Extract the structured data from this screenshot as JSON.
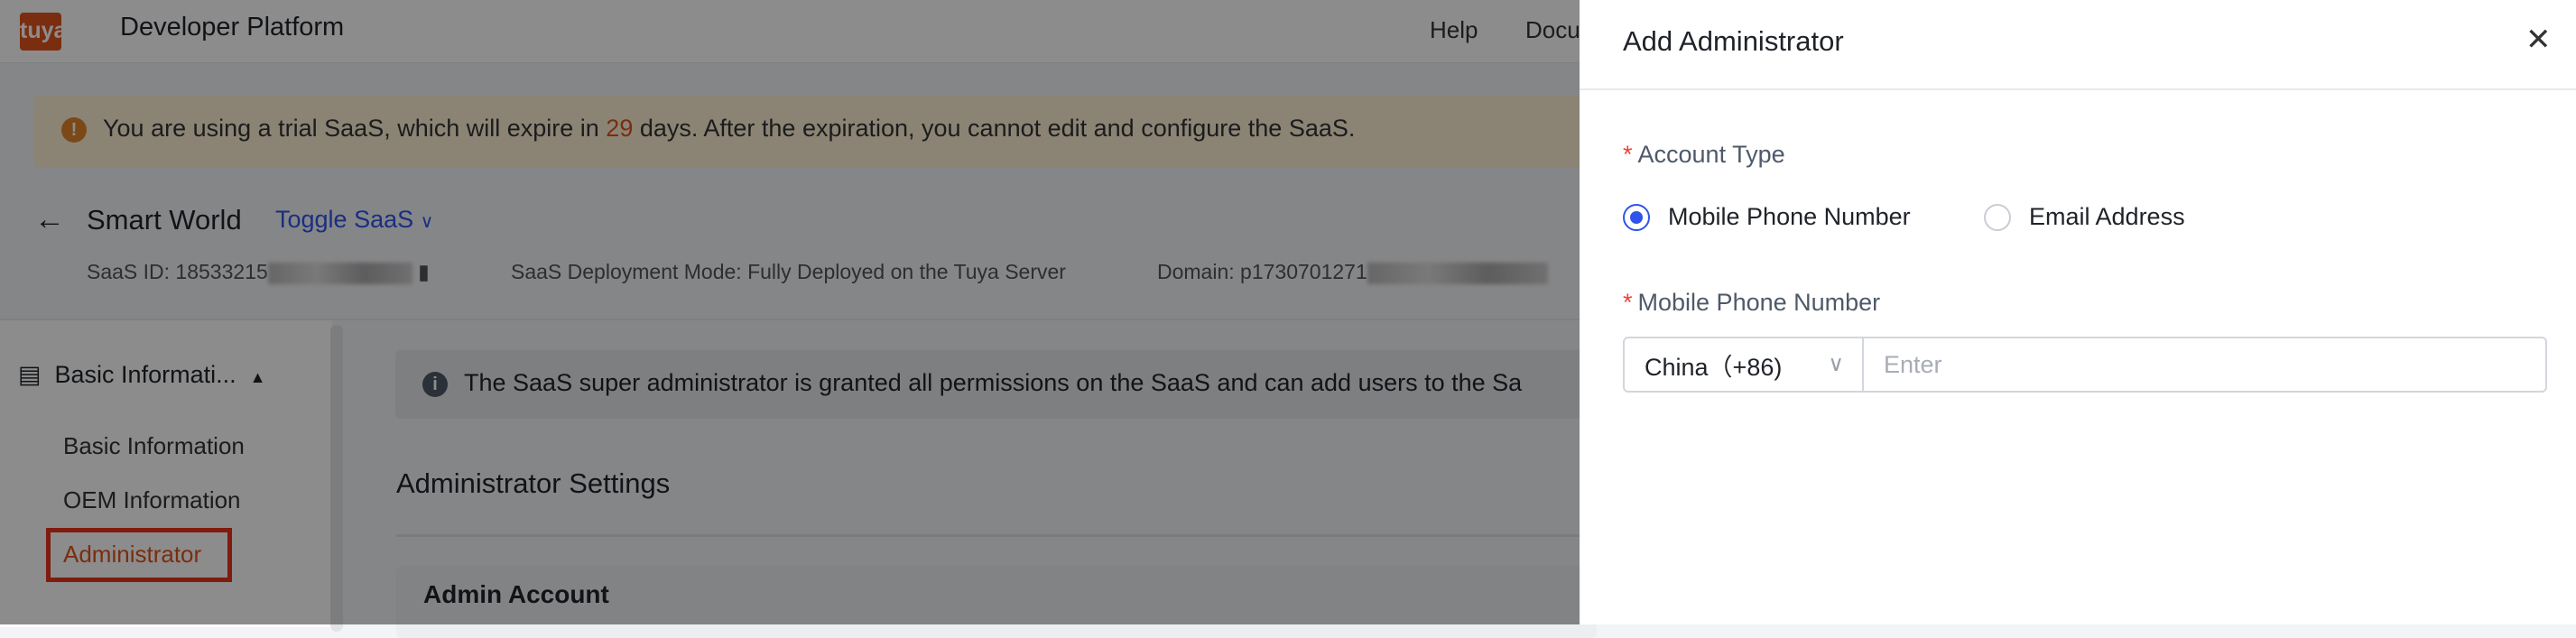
{
  "topbar": {
    "logo": "tuya",
    "brand": "Developer Platform",
    "links": [
      "Help",
      "Docu"
    ]
  },
  "banner": {
    "pre": "You are using a trial SaaS, which will expire in ",
    "days": "29",
    "post": " days. After the expiration, you cannot edit and configure the SaaS.",
    "icon": "warning-icon",
    "accent": "#e0521d"
  },
  "saas": {
    "name": "Smart World",
    "toggle": "Toggle SaaS",
    "id_label": "SaaS ID: 18533215",
    "mode": "SaaS Deployment Mode: Fully Deployed on the Tuya Server",
    "domain": "Domain: p1730701271"
  },
  "sidebar": {
    "group": "Basic Informati...",
    "items": [
      {
        "label": "Basic Information"
      },
      {
        "label": "OEM Information"
      },
      {
        "label": "Administrator",
        "active": true
      }
    ]
  },
  "main": {
    "info": "The SaaS super administrator is granted all permissions on the SaaS and can add users to the Sa",
    "section_title": "Administrator Settings",
    "account_box": "Admin Account"
  },
  "drawer": {
    "title": "Add Administrator",
    "account_type_label": "Account Type",
    "options": [
      {
        "label": "Mobile Phone Number",
        "selected": true
      },
      {
        "label": "Email Address",
        "selected": false
      }
    ],
    "phone_label": "Mobile Phone Number",
    "country": "China（+86)",
    "phone_placeholder": "Enter",
    "phone_value": "",
    "primary": "#2f54eb"
  }
}
